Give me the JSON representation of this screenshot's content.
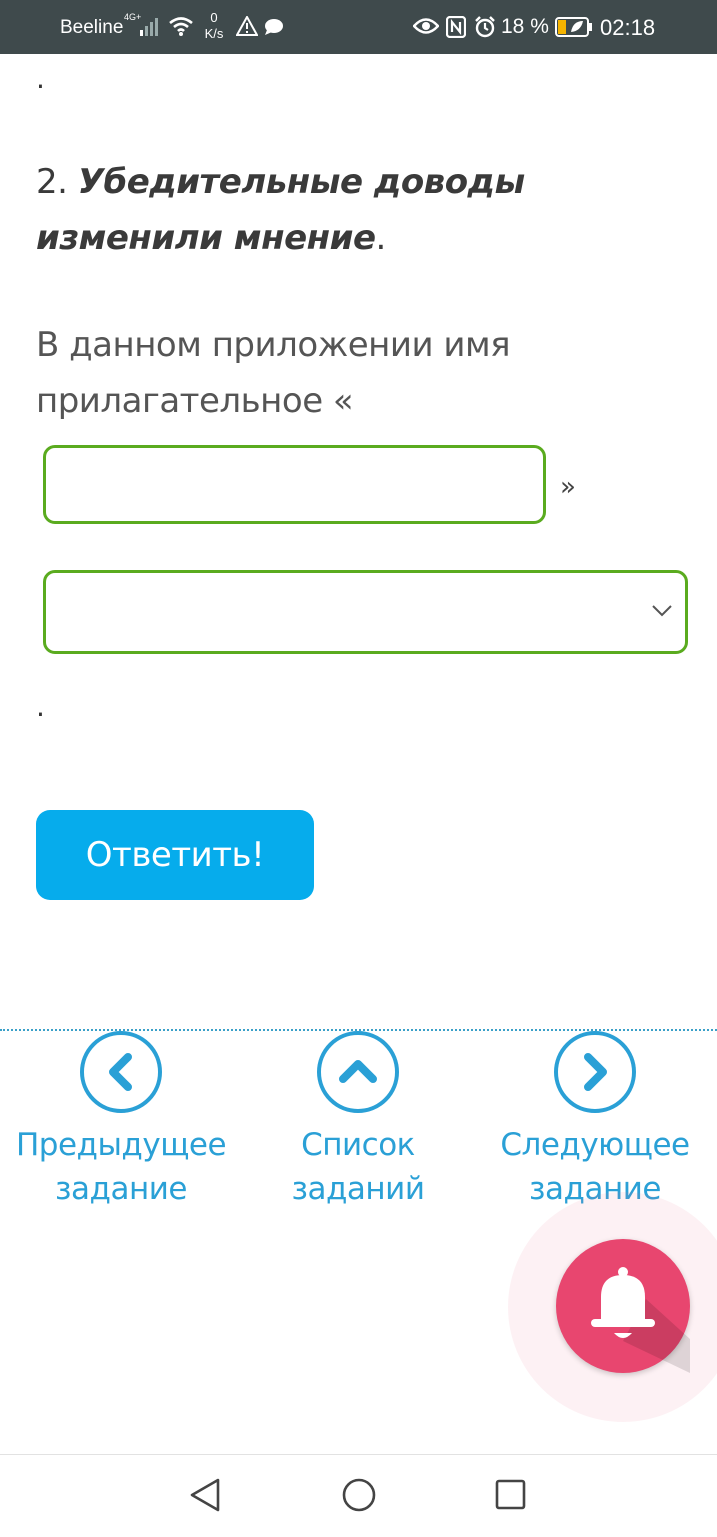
{
  "status_bar": {
    "carrier": "Beeline",
    "network_type": "4G+",
    "speed_value": "0",
    "speed_unit": "K/s",
    "battery_percent": "18 %",
    "time": "02:18",
    "icons": [
      "signal-icon",
      "wifi-icon",
      "warning-icon",
      "chat-icon",
      "eye-icon",
      "nfc-icon",
      "alarm-icon",
      "battery-icon"
    ]
  },
  "task": {
    "top_punct": ".",
    "sentence_number": "2.",
    "sentence_text": "Убедительные доводы изменили мнение",
    "sentence_end": ".",
    "prompt_text": "В данном приложении имя прилагательное «",
    "close_quote": "»",
    "answer_input": {
      "value": "",
      "placeholder": ""
    },
    "role_select": {
      "selected": ""
    },
    "after_punct": ".",
    "submit_label": "Ответить!"
  },
  "bottom_nav": {
    "prev": {
      "line1": "Предыдущее",
      "line2": "задание",
      "icon": "chevron-left-icon"
    },
    "list": {
      "line1": "Список",
      "line2": "заданий",
      "icon": "chevron-up-icon"
    },
    "next": {
      "line1": "Следующее",
      "line2": "задание",
      "icon": "chevron-right-icon"
    }
  },
  "fab": {
    "icon": "bell-icon"
  },
  "colors": {
    "accent_blue": "#06acec",
    "nav_blue": "#2aa0d6",
    "input_green": "#5aab1f",
    "fab_pink": "#e8466f",
    "status_bar_bg": "#3f4a4c"
  },
  "system_nav": [
    "back-icon",
    "home-icon",
    "recents-icon"
  ]
}
